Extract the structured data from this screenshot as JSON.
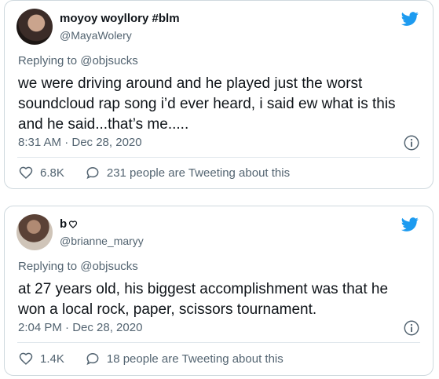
{
  "tweets": [
    {
      "display_name": "moyoy woyllory #blm",
      "handle": "@MayaWolery",
      "replying_label": "Replying to",
      "replying_to": "@objsucks",
      "text": "we were driving around and he  played just the worst soundcloud rap song i’d ever heard, i said ew what is this and he said...that’s me.....",
      "timestamp": "8:31 AM · Dec 28, 2020",
      "likes": "6.8K",
      "tweeting_about": "231 people are Tweeting about this"
    },
    {
      "display_name": "b",
      "handle": "@brianne_maryy",
      "replying_label": "Replying to",
      "replying_to": "@objsucks",
      "text": "at 27 years old, his biggest accomplishment was that he won a local rock, paper, scissors tournament.",
      "timestamp": "2:04 PM · Dec 28, 2020",
      "likes": "1.4K",
      "tweeting_about": "18 people are Tweeting about this"
    }
  ],
  "colors": {
    "twitter_blue": "#1d9bf0",
    "secondary_text": "#536471",
    "border": "#cfd9de"
  },
  "icons": [
    "twitter-bird-icon",
    "info-icon",
    "heart-icon",
    "reply-bubble-icon"
  ]
}
